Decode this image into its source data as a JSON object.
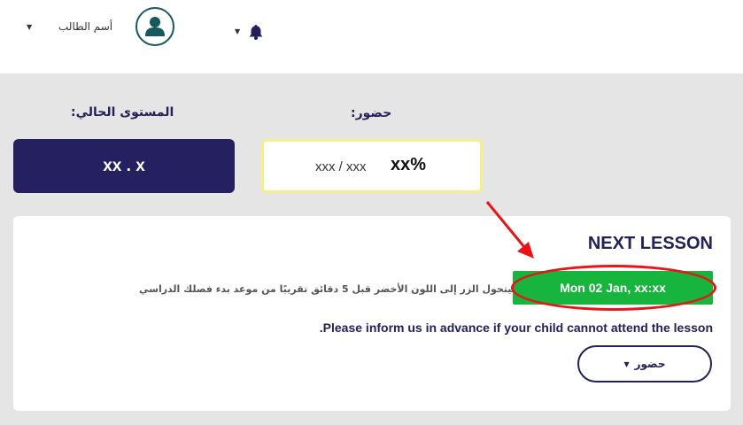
{
  "header": {
    "student_name": "أسم الطالب",
    "avatar_icon": "user-avatar-icon",
    "notifications_icon": "bell-icon",
    "dropdown_icon": "caret-down-icon"
  },
  "summary": {
    "current_level_label": "المستوى الحالي:",
    "current_level_value": "xx . x",
    "attendance_label": "حضور:",
    "attendance_count": "xxx / xxx",
    "attendance_percent": "xx%"
  },
  "next_lesson": {
    "title": "NEXT LESSON",
    "button_label": "Mon 02 Jan, xx:xx",
    "hint": "سيتحول الزر إلى اللون الأخضر قبل 5 دقائق تقريبًا من موعد بدء فصلك الدراسي",
    "inform_text": ".Please inform us in advance if your child cannot attend the lesson",
    "attendance_select": "حضور",
    "colors": {
      "green": "#17b53d",
      "navy": "#252060",
      "highlight": "#e81418"
    }
  }
}
